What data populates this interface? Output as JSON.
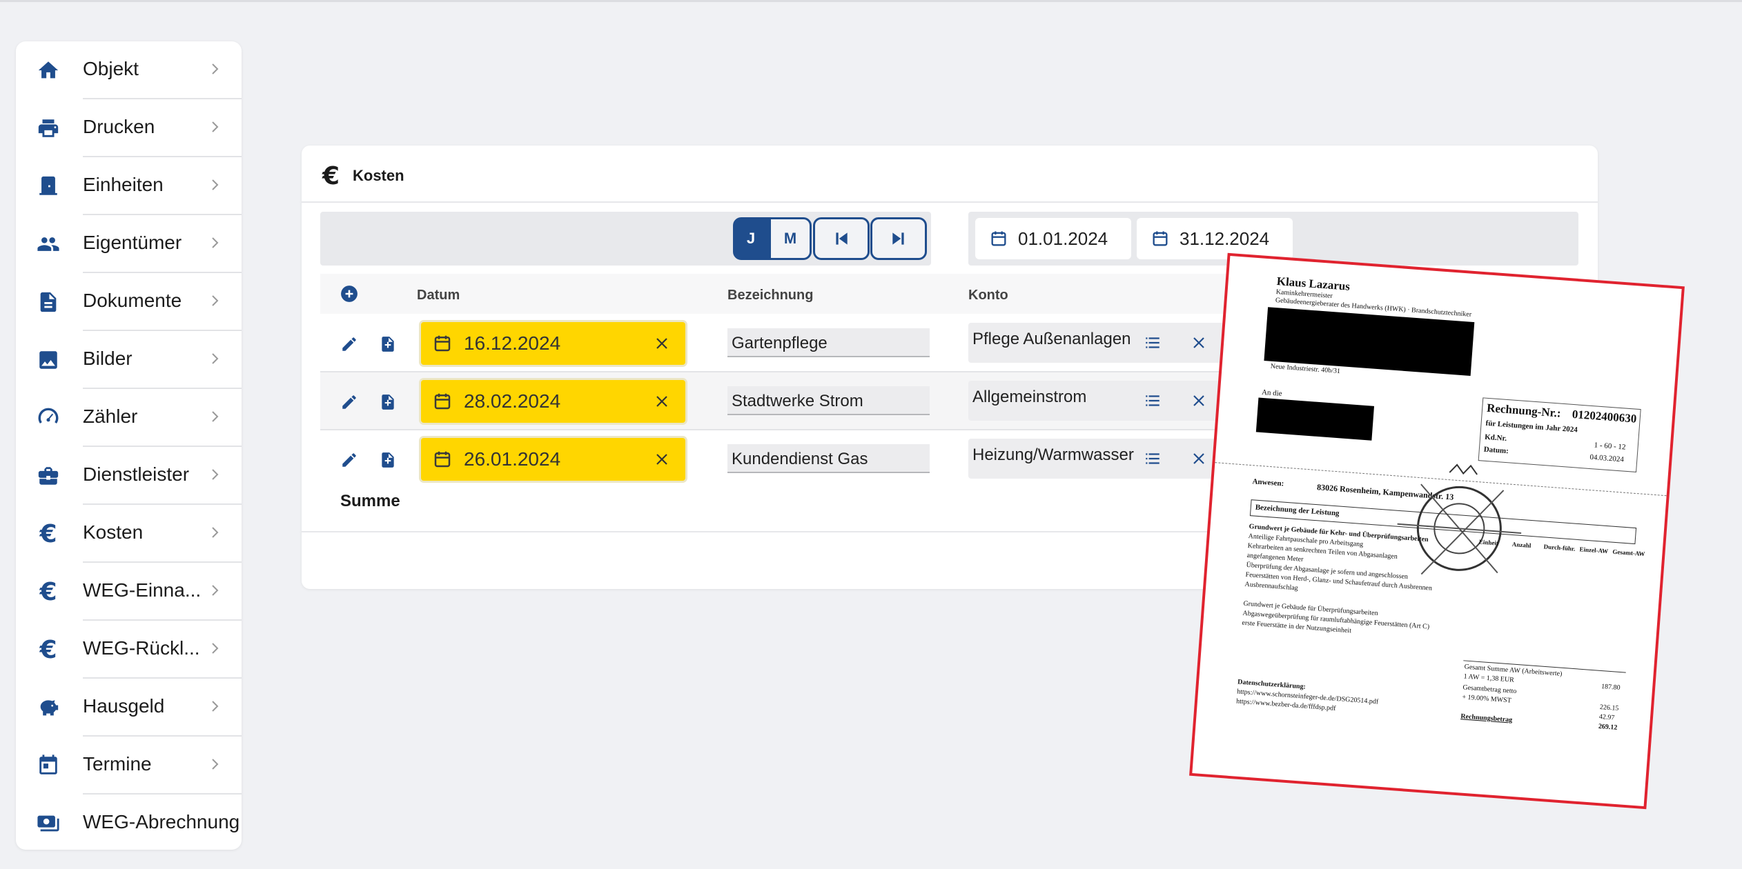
{
  "sidebar": {
    "items": [
      {
        "label": "Objekt",
        "icon": "home-icon"
      },
      {
        "label": "Drucken",
        "icon": "printer-icon"
      },
      {
        "label": "Einheiten",
        "icon": "door-icon"
      },
      {
        "label": "Eigentümer",
        "icon": "people-icon"
      },
      {
        "label": "Dokumente",
        "icon": "document-icon"
      },
      {
        "label": "Bilder",
        "icon": "image-icon"
      },
      {
        "label": "Zähler",
        "icon": "gauge-icon"
      },
      {
        "label": "Dienstleister",
        "icon": "briefcase-icon"
      },
      {
        "label": "Kosten",
        "icon": "euro-icon"
      },
      {
        "label": "WEG-Einna...",
        "icon": "euro-icon"
      },
      {
        "label": "WEG-Rückl...",
        "icon": "euro-icon"
      },
      {
        "label": "Hausgeld",
        "icon": "piggy-bank-icon"
      },
      {
        "label": "Termine",
        "icon": "calendar-icon"
      },
      {
        "label": "WEG-Abrechnung",
        "icon": "money-icon"
      }
    ]
  },
  "card": {
    "title": "Kosten",
    "euro_symbol": "€",
    "period_buttons": {
      "year": "J",
      "month": "M"
    },
    "date_from": "01.01.2024",
    "date_to": "31.12.2024",
    "columns": {
      "datum": "Datum",
      "bezeichnung": "Bezeichnung",
      "konto": "Konto"
    },
    "rows": [
      {
        "datum": "16.12.2024",
        "bezeichnung": "Gartenpflege",
        "konto": "Pflege Außenanlagen"
      },
      {
        "datum": "28.02.2024",
        "bezeichnung": "Stadtwerke Strom",
        "konto": "Allgemeinstrom"
      },
      {
        "datum": "26.01.2024",
        "bezeichnung": "Kundendienst Gas",
        "konto": "Heizung/Warmwasser"
      }
    ],
    "summe_label": "Summe"
  },
  "invoice": {
    "name": "Klaus Lazarus",
    "subtitle1": "Kaminkehrermeister",
    "subtitle2": "Gebäudeenergieberater des Handwerks (HWK) · Brandschutztechniker",
    "street": "Neue Industriestr. 40b/31",
    "an_label": "An die",
    "rechnung_label": "Rechnung-Nr.:",
    "rechnung_nr": "01202400630",
    "leistung": "für Leistungen im Jahr 2024",
    "kd_label": "Kd.Nr.",
    "kd_nr": "1 - 60 - 12",
    "datum_label": "Datum:",
    "datum": "04.03.2024",
    "anwesen_label": "Anwesen:",
    "anwesen": "83026 Rosenheim, Kampenwandstr. 13",
    "bez_label": "Bezeichnung der Leistung",
    "col_headers": [
      "Einheit",
      "Anzahl",
      "Durch-führ.",
      "Einzel-AW",
      "Gesamt-AW"
    ],
    "lines": [
      "Grundwert je Gebäude für Kehr- und Überprüfungsarbeiten",
      "Anteilige Fahrtpauschale pro Arbeitsgang",
      "Kehrarbeiten an senkrechten Teilen von Abgasanlagen",
      "angefangenen Meter",
      "Überprüfung der Abgasanlage je sofern und angeschlossen",
      "Feuerstätten von Herd-, Glanz- und Schaufetrauf durch Ausbrennen",
      "Ausbrennaufschlag",
      "Grundwert je Gebäude für Überprüfungsarbeiten",
      "Abgaswegeüberprüfung für raumluftabhängige Feuerstätten (Art C)",
      "erste Feuerstätte in der Nutzungseinheit"
    ],
    "summe_aw_label": "Gesamt Summe AW (Arbeitswerte)",
    "summe_aw": "187.80",
    "aw_rate": "1 AW = 1,38 EUR",
    "netto_label": "Gesamtbetrag netto",
    "netto": "226.15",
    "mwst_label": "+ 19.00% MWST",
    "mwst": "42.97",
    "brutto_label": "Rechnungsbetrag",
    "brutto": "269.12",
    "ds_label": "Datenschutzerklärung:",
    "ds_link1": "https://www.schornsteinfeger-de.de/DSG20514.pdf",
    "ds_link2": "https://www.bezber-da.de/fffdsp.pdf"
  }
}
